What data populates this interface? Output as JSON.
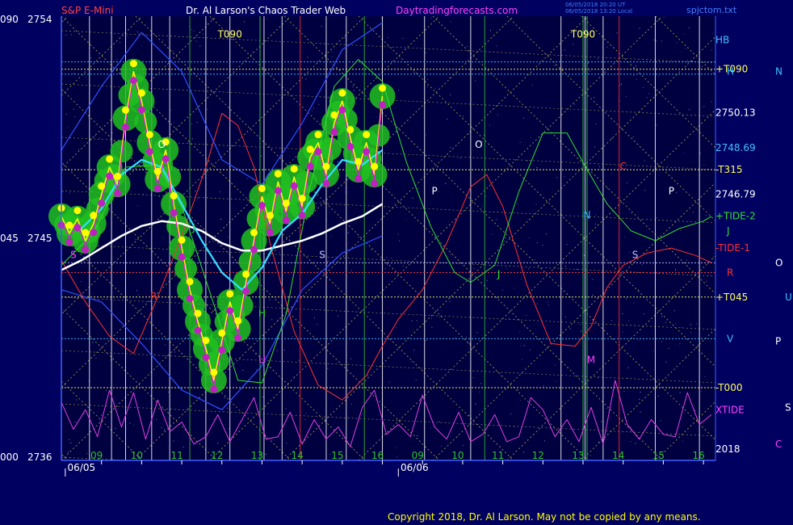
{
  "header": {
    "instrument": "S&P E-Mini",
    "title": "Dr. Al Larson's Chaos Trader Web",
    "site": "Daytradingforecasts.com",
    "stamp_line1": "06/05/2018 20:20 UT",
    "stamp_line2": "06/05/2018 13:20 Local",
    "file": "spjctom.txt"
  },
  "copyright": "Copyright 2018, Dr. Al Larson. May not be copied by any means.",
  "colors": {
    "background": "#000060",
    "plot_bg": "#000040",
    "ema_cyan": "#33e0ff",
    "ma_white": "#ffffff",
    "price_yellow": "#ffff00",
    "price_magenta": "#ff00ff",
    "tide1_red": "#ff3030",
    "tide2_green": "#30e030",
    "xtide_magenta": "#e040e0",
    "envelope_green": "#20c020",
    "grid_yellow": "#d8d860",
    "label_cyan": "#40c0ff"
  },
  "chart_data": {
    "type": "line",
    "ylim": [
      2736,
      2754
    ],
    "y_ticks": [
      {
        "left": "090",
        "value": 2754,
        "label": "2754"
      },
      {
        "left": "045",
        "value": 2745,
        "label": "2745"
      },
      {
        "left": "000",
        "value": 2736,
        "label": "2736"
      }
    ],
    "x_hours": [
      {
        "label": "09",
        "x": 9
      },
      {
        "label": "10",
        "x": 10
      },
      {
        "label": "11",
        "x": 11
      },
      {
        "label": "12",
        "x": 12
      },
      {
        "label": "13",
        "x": 13
      },
      {
        "label": "14",
        "x": 14
      },
      {
        "label": "15",
        "x": 15
      },
      {
        "label": "16",
        "x": 16
      },
      {
        "label": "09",
        "x": 17
      },
      {
        "label": "10",
        "x": 18
      },
      {
        "label": "11",
        "x": 19
      },
      {
        "label": "12",
        "x": 20
      },
      {
        "label": "13",
        "x": 21
      },
      {
        "label": "14",
        "x": 22
      },
      {
        "label": "15",
        "x": 23
      },
      {
        "label": "16",
        "x": 24
      }
    ],
    "xlim": [
      8.0,
      24.3
    ],
    "dates": [
      {
        "label": "06/05",
        "x": 8.5
      },
      {
        "label": "06/06",
        "x": 16.8
      }
    ],
    "right_labels": [
      {
        "text": "HB",
        "y": 2753.1,
        "color": "#40c0ff",
        "col": "a"
      },
      {
        "text": "+T090",
        "y": 2751.9,
        "color": "#ffff60",
        "col": "a"
      },
      {
        "text": "H",
        "y": 2751.8,
        "color": "#40c0ff",
        "col": "b"
      },
      {
        "text": "N",
        "y": 2751.8,
        "color": "#40c0ff",
        "col": "c"
      },
      {
        "text": "2750.13",
        "y": 2750.13,
        "color": "#ffffff",
        "col": "a"
      },
      {
        "text": "2748.69",
        "y": 2748.69,
        "color": "#40c0ff",
        "col": "a"
      },
      {
        "text": "-T315",
        "y": 2747.8,
        "color": "#ffff60",
        "col": "a"
      },
      {
        "text": "2746.79",
        "y": 2746.79,
        "color": "#ffffff",
        "col": "a"
      },
      {
        "text": "+TIDE-2",
        "y": 2745.9,
        "color": "#30e030",
        "col": "a"
      },
      {
        "text": "J",
        "y": 2745.3,
        "color": "#30e030",
        "col": "b"
      },
      {
        "text": "-TIDE-1",
        "y": 2744.6,
        "color": "#ff3030",
        "col": "a"
      },
      {
        "text": "O",
        "y": 2744.0,
        "color": "#ffffff",
        "col": "c"
      },
      {
        "text": "R",
        "y": 2743.6,
        "color": "#ff3030",
        "col": "b"
      },
      {
        "text": "+T045",
        "y": 2742.6,
        "color": "#ffff60",
        "col": "a"
      },
      {
        "text": "U",
        "y": 2742.6,
        "color": "#40c0ff",
        "col": "d"
      },
      {
        "text": "V",
        "y": 2740.9,
        "color": "#40c0ff",
        "col": "b"
      },
      {
        "text": "P",
        "y": 2740.8,
        "color": "#ffffff",
        "col": "c"
      },
      {
        "text": "-T000",
        "y": 2738.9,
        "color": "#ffff60",
        "col": "a"
      },
      {
        "text": "S",
        "y": 2738.1,
        "color": "#ffffff",
        "col": "d"
      },
      {
        "text": "XTIDE",
        "y": 2738.0,
        "color": "#ff40ff",
        "col": "a"
      },
      {
        "text": "C",
        "y": 2736.6,
        "color": "#ff40ff",
        "col": "c"
      },
      {
        "text": "2018",
        "y": 2736.4,
        "color": "#ffffff",
        "col": "a"
      }
    ],
    "markers": [
      {
        "text": "T090",
        "x": 12.2,
        "y": 2753.2,
        "color": "#ffff60"
      },
      {
        "text": "T090",
        "x": 21.0,
        "y": 2753.2,
        "color": "#ffff60"
      },
      {
        "text": "O",
        "x": 10.5,
        "y": 2748.7,
        "color": "#ffffff"
      },
      {
        "text": "O",
        "x": 18.4,
        "y": 2748.7,
        "color": "#ffffff"
      },
      {
        "text": "P",
        "x": 17.3,
        "y": 2746.8,
        "color": "#ffffff"
      },
      {
        "text": "P",
        "x": 23.2,
        "y": 2746.8,
        "color": "#ffffff"
      },
      {
        "text": "C",
        "x": 22.0,
        "y": 2747.8,
        "color": "#ff3030"
      },
      {
        "text": "N",
        "x": 21.1,
        "y": 2745.8,
        "color": "#40c0ff"
      },
      {
        "text": "S",
        "x": 14.5,
        "y": 2744.2,
        "color": "#c0c0ff"
      },
      {
        "text": "S",
        "x": 22.3,
        "y": 2744.2,
        "color": "#c0c0ff"
      },
      {
        "text": "J",
        "x": 18.9,
        "y": 2743.4,
        "color": "#30e030"
      },
      {
        "text": "H",
        "x": 13.0,
        "y": 2741.8,
        "color": "#30e030"
      },
      {
        "text": "U",
        "x": 13.0,
        "y": 2739.9,
        "color": "#ff40ff"
      },
      {
        "text": "M",
        "x": 21.2,
        "y": 2739.9,
        "color": "#ff40ff"
      },
      {
        "text": "S",
        "x": 8.3,
        "y": 2744.2,
        "color": "#ff40ff"
      },
      {
        "text": "R",
        "x": 10.3,
        "y": 2742.5,
        "color": "#ff3030"
      },
      {
        "text": "J",
        "x": 11.3,
        "y": 2745.3,
        "color": "#30e030"
      }
    ],
    "series": [
      {
        "name": "price",
        "x": [
          8.0,
          8.2,
          8.4,
          8.6,
          8.8,
          9.0,
          9.2,
          9.4,
          9.6,
          9.8,
          10.0,
          10.2,
          10.4,
          10.6,
          10.8,
          11.0,
          11.2,
          11.4,
          11.6,
          11.8,
          12.0,
          12.2,
          12.4,
          12.6,
          12.8,
          13.0,
          13.2,
          13.4,
          13.6,
          13.8,
          14.0,
          14.2,
          14.4,
          14.6,
          14.8,
          15.0,
          15.2,
          15.4,
          15.6,
          15.8,
          16.0
        ],
        "y": [
          2745.9,
          2745.2,
          2745.8,
          2744.9,
          2745.6,
          2746.8,
          2747.9,
          2747.2,
          2749.9,
          2751.8,
          2750.6,
          2748.9,
          2747.4,
          2748.6,
          2746.4,
          2744.6,
          2742.9,
          2741.6,
          2740.5,
          2739.2,
          2740.8,
          2742.4,
          2741.3,
          2743.2,
          2744.9,
          2746.7,
          2745.6,
          2747.3,
          2746.1,
          2747.5,
          2746.3,
          2748.3,
          2748.9,
          2747.6,
          2749.7,
          2750.6,
          2749.1,
          2747.8,
          2748.9,
          2747.6,
          2750.8
        ]
      },
      {
        "name": "ema",
        "x": [
          8.0,
          8.5,
          9.0,
          9.5,
          10.0,
          10.5,
          11.0,
          11.5,
          12.0,
          12.5,
          13.0,
          13.5,
          14.0,
          14.5,
          15.0,
          15.5,
          16.0
        ],
        "y": [
          2745.6,
          2745.4,
          2746.2,
          2747.6,
          2748.2,
          2747.9,
          2746.4,
          2744.9,
          2743.6,
          2742.9,
          2743.8,
          2745.3,
          2746.0,
          2747.2,
          2748.2,
          2748.0,
          2748.6
        ]
      },
      {
        "name": "ma",
        "x": [
          8.0,
          8.5,
          9.0,
          9.5,
          10.0,
          10.5,
          11.0,
          11.5,
          12.0,
          12.5,
          13.0,
          13.5,
          14.0,
          14.5,
          15.0,
          15.5,
          16.0
        ],
        "y": [
          2743.7,
          2744.1,
          2744.6,
          2745.1,
          2745.5,
          2745.7,
          2745.6,
          2745.3,
          2744.8,
          2744.5,
          2744.5,
          2744.7,
          2744.9,
          2745.2,
          2745.6,
          2745.9,
          2746.4
        ]
      },
      {
        "name": "TIDE-1",
        "x": [
          8.0,
          8.6,
          9.2,
          9.8,
          10.4,
          11.0,
          11.6,
          12.0,
          12.4,
          12.8,
          13.2,
          13.8,
          14.4,
          15.0,
          15.6,
          16.0,
          16.4,
          17.0,
          17.6,
          18.2,
          18.6,
          19.0,
          19.6,
          20.2,
          20.8,
          21.2,
          21.6,
          22.0,
          22.6,
          23.2,
          23.8,
          24.2
        ],
        "y": [
          2744.1,
          2742.4,
          2741.0,
          2740.3,
          2742.6,
          2745.1,
          2747.9,
          2750.1,
          2749.6,
          2747.9,
          2744.8,
          2741.2,
          2739.0,
          2738.4,
          2739.4,
          2740.6,
          2741.7,
          2742.9,
          2744.8,
          2747.1,
          2747.6,
          2746.3,
          2743.1,
          2740.7,
          2740.6,
          2741.4,
          2743.0,
          2743.9,
          2744.4,
          2744.6,
          2744.3,
          2744.0
        ]
      },
      {
        "name": "TIDE-2",
        "x": [
          8.0,
          8.8,
          9.6,
          10.4,
          11.0,
          11.8,
          12.4,
          13.0,
          13.6,
          14.2,
          14.8,
          15.4,
          16.0,
          16.6,
          17.2,
          17.8,
          18.2,
          18.8,
          19.4,
          20.0,
          20.6,
          21.0,
          21.6,
          22.2,
          22.8,
          23.4,
          24.0,
          24.2
        ],
        "y": [
          2743.9,
          2745.2,
          2747.9,
          2748.0,
          2746.3,
          2742.3,
          2739.2,
          2739.1,
          2741.9,
          2747.1,
          2751.2,
          2752.3,
          2751.4,
          2748.1,
          2745.5,
          2743.6,
          2743.2,
          2743.9,
          2746.9,
          2749.3,
          2749.3,
          2748.1,
          2746.4,
          2745.3,
          2744.9,
          2745.4,
          2745.7,
          2745.9
        ]
      },
      {
        "name": "XTIDE",
        "x": [
          8.0,
          8.3,
          8.6,
          8.9,
          9.2,
          9.5,
          9.8,
          10.1,
          10.4,
          10.7,
          11.0,
          11.3,
          11.6,
          11.9,
          12.2,
          12.5,
          12.8,
          13.1,
          13.4,
          13.7,
          14.0,
          14.3,
          14.6,
          14.9,
          15.2,
          15.5,
          15.8,
          16.1,
          16.4,
          16.7,
          17.0,
          17.3,
          17.6,
          17.9,
          18.2,
          18.5,
          18.8,
          19.1,
          19.4,
          19.7,
          20.0,
          20.3,
          20.6,
          20.9,
          21.2,
          21.5,
          21.8,
          22.1,
          22.4,
          22.7,
          23.0,
          23.3,
          23.6,
          23.9,
          24.2
        ],
        "y": [
          2738.3,
          2737.2,
          2738.0,
          2736.9,
          2738.8,
          2737.3,
          2738.7,
          2736.8,
          2738.4,
          2737.1,
          2737.5,
          2736.6,
          2736.9,
          2737.8,
          2736.7,
          2737.6,
          2738.5,
          2736.8,
          2736.9,
          2737.9,
          2736.6,
          2737.6,
          2736.8,
          2737.3,
          2736.5,
          2738.1,
          2738.8,
          2737.0,
          2737.4,
          2736.9,
          2738.6,
          2737.3,
          2736.8,
          2737.9,
          2736.7,
          2737.0,
          2737.8,
          2736.7,
          2736.9,
          2738.5,
          2738.0,
          2736.9,
          2737.6,
          2736.7,
          2738.1,
          2736.6,
          2739.2,
          2737.4,
          2736.8,
          2737.6,
          2737.0,
          2736.9,
          2738.7,
          2737.4,
          2737.8
        ]
      },
      {
        "name": "upper-band",
        "x": [
          8.0,
          9.0,
          10.0,
          11.0,
          12.0,
          13.0,
          14.0,
          15.0,
          16.0
        ],
        "y": [
          2748.6,
          2751.2,
          2753.4,
          2751.8,
          2748.2,
          2747.2,
          2749.7,
          2752.7,
          2753.8
        ]
      },
      {
        "name": "lower-band",
        "x": [
          8.0,
          9.0,
          10.0,
          11.0,
          12.0,
          13.0,
          14.0,
          15.0,
          16.0
        ],
        "y": [
          2742.9,
          2742.4,
          2740.7,
          2738.8,
          2738.0,
          2739.8,
          2742.9,
          2744.4,
          2745.1
        ]
      }
    ],
    "level_lines": [
      {
        "y": 2752.2,
        "color": "#40c0ff"
      },
      {
        "y": 2751.9,
        "color": "#ffff60"
      },
      {
        "y": 2751.7,
        "color": "#40c0ff"
      },
      {
        "y": 2747.8,
        "color": "#ffff60"
      },
      {
        "y": 2744.0,
        "color": "#c0c0ff"
      },
      {
        "y": 2743.6,
        "color": "#ff4040"
      },
      {
        "y": 2742.6,
        "color": "#ffff60"
      },
      {
        "y": 2740.9,
        "color": "#40c0ff"
      },
      {
        "y": 2738.9,
        "color": "#ffff60"
      }
    ],
    "vertical_lines": [
      {
        "x": 8.7,
        "color": "#ffffff"
      },
      {
        "x": 9.25,
        "color": "#ffffff"
      },
      {
        "x": 9.6,
        "color": "#ffffff"
      },
      {
        "x": 10.25,
        "color": "#ffffff"
      },
      {
        "x": 10.7,
        "color": "#ffffff"
      },
      {
        "x": 11.2,
        "color": "#30c030"
      },
      {
        "x": 11.6,
        "color": "#ffffff"
      },
      {
        "x": 12.2,
        "color": "#ffffff"
      },
      {
        "x": 12.95,
        "color": "#30e030"
      },
      {
        "x": 13.05,
        "color": "#ffffff"
      },
      {
        "x": 13.5,
        "color": "#ffffff"
      },
      {
        "x": 13.95,
        "color": "#ff3030"
      },
      {
        "x": 14.6,
        "color": "#ffffff"
      },
      {
        "x": 15.1,
        "color": "#ffffff"
      },
      {
        "x": 15.55,
        "color": "#30c030"
      },
      {
        "x": 16.0,
        "color": "#ffffff"
      },
      {
        "x": 17.05,
        "color": "#ffffff"
      },
      {
        "x": 18.2,
        "color": "#ffffff"
      },
      {
        "x": 18.55,
        "color": "#30c030"
      },
      {
        "x": 20.45,
        "color": "#ffffff"
      },
      {
        "x": 21.0,
        "color": "#30e030"
      },
      {
        "x": 21.05,
        "color": "#ffffff"
      },
      {
        "x": 21.1,
        "color": "#30e030"
      },
      {
        "x": 21.5,
        "color": "#ffffff"
      },
      {
        "x": 21.9,
        "color": "#ff3030"
      },
      {
        "x": 22.8,
        "color": "#ffffff"
      },
      {
        "x": 23.9,
        "color": "#ffffff"
      }
    ]
  }
}
